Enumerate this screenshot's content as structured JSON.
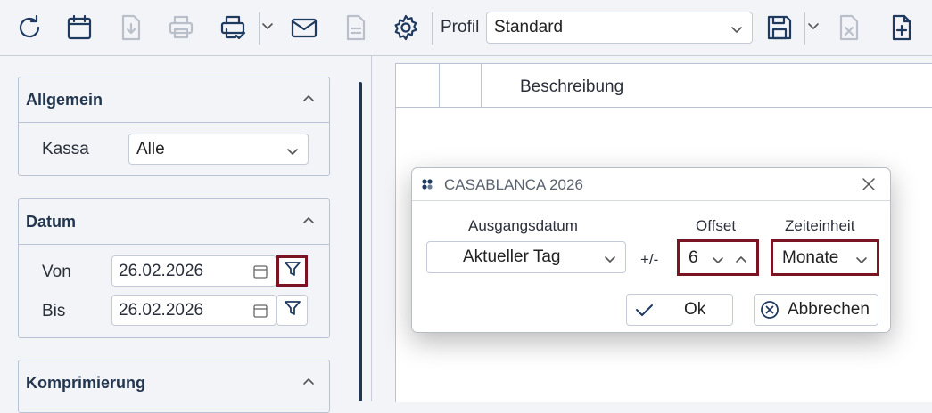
{
  "toolbar": {
    "profil_label": "Profil",
    "profil_value": "Standard",
    "icons": [
      "refresh-icon",
      "calendar-icon",
      "download-icon",
      "print-icon",
      "print-dropdown-icon",
      "mail-icon",
      "document-icon",
      "gear-icon",
      "save-icon",
      "delete-document-icon",
      "new-document-icon"
    ]
  },
  "left_panel": {
    "allgemein": {
      "title": "Allgemein",
      "kassa_label": "Kassa",
      "kassa_value": "Alle"
    },
    "datum": {
      "title": "Datum",
      "von_label": "Von",
      "von_value": "26.02.2026",
      "bis_label": "Bis",
      "bis_value": "26.02.2026"
    },
    "komprimierung": {
      "title": "Komprimierung"
    }
  },
  "grid": {
    "columns": [
      "",
      "",
      "Beschreibung"
    ]
  },
  "dialog": {
    "title": "CASABLANCA 2026",
    "ausgangsdatum_label": "Ausgangsdatum",
    "ausgangsdatum_value": "Aktueller Tag",
    "plusminus": "+/-",
    "offset_label": "Offset",
    "offset_value": "6",
    "zeiteinheit_label": "Zeiteinheit",
    "zeiteinheit_value": "Monate",
    "ok_label": "Ok",
    "cancel_label": "Abbrechen"
  },
  "colors": {
    "accent_dark": "#1f3a5f",
    "highlight_border": "#7a1423",
    "background": "#f3f4f7"
  }
}
